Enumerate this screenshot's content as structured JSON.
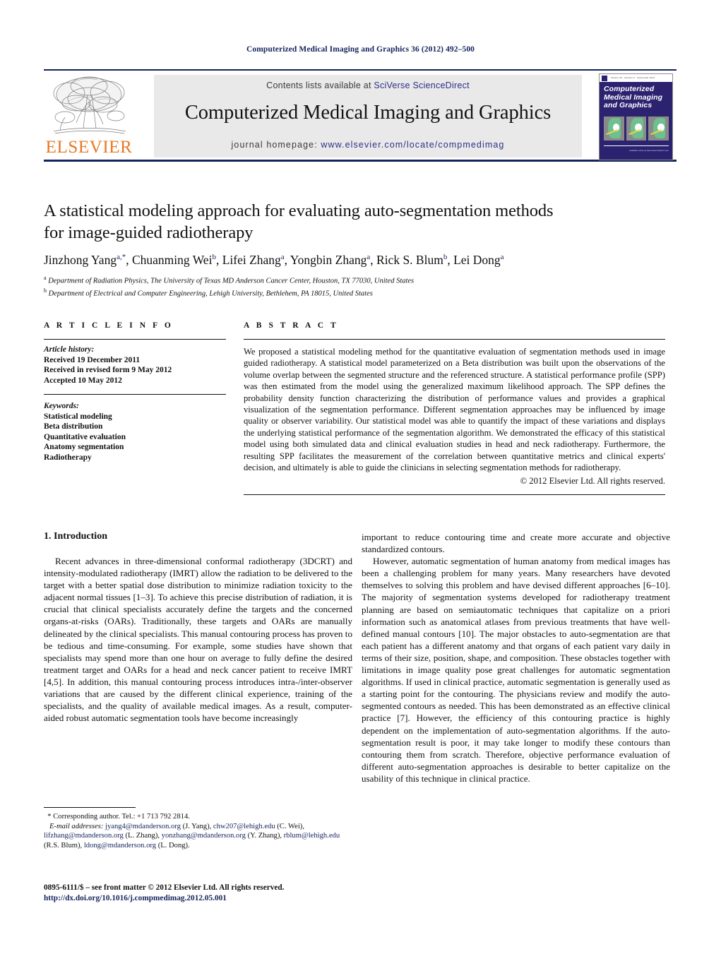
{
  "running_head": "Computerized Medical Imaging and Graphics 36 (2012) 492–500",
  "masthead": {
    "contents_prefix": "Contents lists available at ",
    "contents_link": "SciVerse ScienceDirect",
    "journal_title": "Computerized Medical Imaging and Graphics",
    "homepage_label": "journal homepage: ",
    "homepage_url": "www.elsevier.com/locate/compmedimag",
    "publisher": "ELSEVIER",
    "cover": {
      "title_line1": "Computerized",
      "title_line2": "Medical Imaging",
      "title_line3": "and Graphics",
      "masthead_strip": "Volume 36 · Number 6 · September 2012",
      "footer_strip": "available online at www.sciencedirect.com"
    }
  },
  "article": {
    "title_line1": "A statistical modeling approach for evaluating auto-segmentation methods",
    "title_line2": "for image-guided radiotherapy",
    "authors": [
      {
        "name": "Jinzhong Yang",
        "sup": "a,",
        "star": "*"
      },
      {
        "name": "Chuanming Wei",
        "sup": "b"
      },
      {
        "name": "Lifei Zhang",
        "sup": "a"
      },
      {
        "name": "Yongbin Zhang",
        "sup": "a"
      },
      {
        "name": "Rick S. Blum",
        "sup": "b"
      },
      {
        "name": "Lei Dong",
        "sup": "a"
      }
    ],
    "affiliations": [
      {
        "marker": "a",
        "text": "Department of Radiation Physics, The University of Texas MD Anderson Cancer Center, Houston, TX 77030, United States"
      },
      {
        "marker": "b",
        "text": "Department of Electrical and Computer Engineering, Lehigh University, Bethlehem, PA 18015, United States"
      }
    ]
  },
  "article_info": {
    "heading": "A R T I C L E  I N F O",
    "history_label": "Article history:",
    "history": [
      "Received 19 December 2011",
      "Received in revised form 9 May 2012",
      "Accepted 10 May 2012"
    ],
    "keywords_label": "Keywords:",
    "keywords": [
      "Statistical modeling",
      "Beta distribution",
      "Quantitative evaluation",
      "Anatomy segmentation",
      "Radiotherapy"
    ]
  },
  "abstract": {
    "heading": "A B S T R A C T",
    "text": "We proposed a statistical modeling method for the quantitative evaluation of segmentation methods used in image guided radiotherapy. A statistical model parameterized on a Beta distribution was built upon the observations of the volume overlap between the segmented structure and the referenced structure. A statistical performance profile (SPP) was then estimated from the model using the generalized maximum likelihood approach. The SPP defines the probability density function characterizing the distribution of performance values and provides a graphical visualization of the segmentation performance. Different segmentation approaches may be influenced by image quality or observer variability. Our statistical model was able to quantify the impact of these variations and displays the underlying statistical performance of the segmentation algorithm. We demonstrated the efficacy of this statistical model using both simulated data and clinical evaluation studies in head and neck radiotherapy. Furthermore, the resulting SPP facilitates the measurement of the correlation between quantitative metrics and clinical experts' decision, and ultimately is able to guide the clinicians in selecting segmentation methods for radiotherapy.",
    "copyright": "© 2012 Elsevier Ltd. All rights reserved."
  },
  "body": {
    "section_heading": "1. Introduction",
    "left_paragraphs": [
      "Recent advances in three-dimensional conformal radiotherapy (3DCRT) and intensity-modulated radiotherapy (IMRT) allow the radiation to be delivered to the target with a better spatial dose distribution to minimize radiation toxicity to the adjacent normal tissues [1–3]. To achieve this precise distribution of radiation, it is crucial that clinical specialists accurately define the targets and the concerned organs-at-risks (OARs). Traditionally, these targets and OARs are manually delineated by the clinical specialists. This manual contouring process has proven to be tedious and time-consuming. For example, some studies have shown that specialists may spend more than one hour on average to fully define the desired treatment target and OARs for a head and neck cancer patient to receive IMRT [4,5]. In addition, this manual contouring process introduces intra-/inter-observer variations that are caused by the different clinical experience, training of the specialists, and the quality of available medical images. As a result, computer-aided robust automatic segmentation tools have become increasingly"
    ],
    "right_paragraphs": [
      "important to reduce contouring time and create more accurate and objective standardized contours.",
      "However, automatic segmentation of human anatomy from medical images has been a challenging problem for many years. Many researchers have devoted themselves to solving this problem and have devised different approaches [6–10]. The majority of segmentation systems developed for radiotherapy treatment planning are based on semiautomatic techniques that capitalize on a priori information such as anatomical atlases from previous treatments that have well-defined manual contours [10]. The major obstacles to auto-segmentation are that each patient has a different anatomy and that organs of each patient vary daily in terms of their size, position, shape, and composition. These obstacles together with limitations in image quality pose great challenges for automatic segmentation algorithms. If used in clinical practice, automatic segmentation is generally used as a starting point for the contouring. The physicians review and modify the auto-segmented contours as needed. This has been demonstrated as an effective clinical practice [7]. However, the efficiency of this contouring practice is highly dependent on the implementation of auto-segmentation algorithms. If the auto-segmentation result is poor, it may take longer to modify these contours than contouring them from scratch. Therefore, objective performance evaluation of different auto-segmentation approaches is desirable to better capitalize on the usability of this technique in clinical practice."
    ]
  },
  "footnotes": {
    "corresponding": "* Corresponding author. Tel.: +1 713 792 2814.",
    "email_label": "E-mail addresses:",
    "emails": [
      {
        "address": "jyang4@mdanderson.org",
        "owner": "(J. Yang)"
      },
      {
        "address": "chw207@lehigh.edu",
        "owner": "(C. Wei)"
      },
      {
        "address": "lifzhang@mdanderson.org",
        "owner": "(L. Zhang)"
      },
      {
        "address": "yonzhang@mdanderson.org",
        "owner": "(Y. Zhang)"
      },
      {
        "address": "rblum@lehigh.edu",
        "owner": "(R.S. Blum)"
      },
      {
        "address": "ldong@mdanderson.org",
        "owner": "(L. Dong)"
      }
    ],
    "issn_line": "0895-6111/$ – see front matter © 2012 Elsevier Ltd. All rights reserved.",
    "doi_line": "http://dx.doi.org/10.1016/j.compmedimag.2012.05.001"
  },
  "colors": {
    "link": "#15245c",
    "elsevier_orange": "#e87722",
    "cover_navy": "#2b2270",
    "band_grey": "#e9e9e9"
  }
}
